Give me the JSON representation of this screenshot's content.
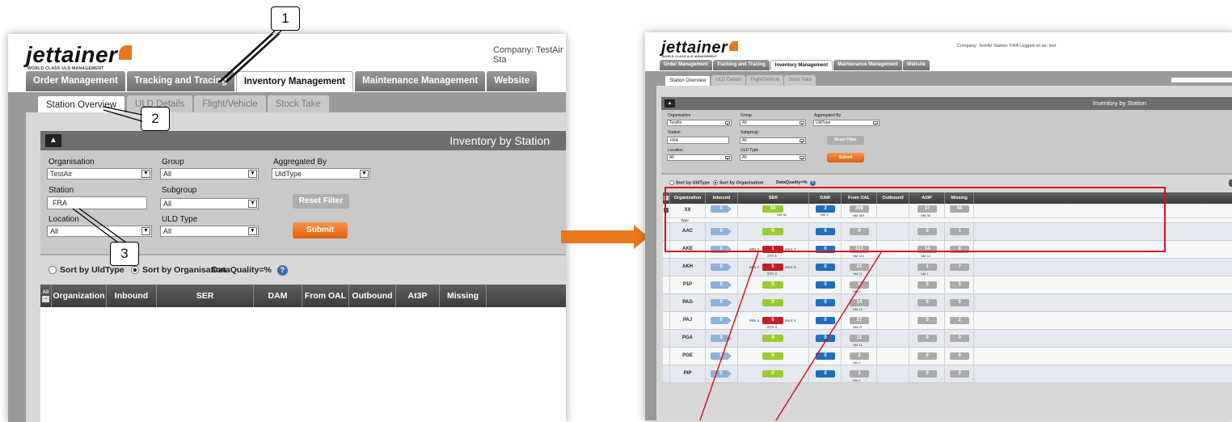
{
  "left": {
    "brand": "jettainer",
    "tagline": "WORLD CLASS ULD MANAGEMENT",
    "company_text": "Company: TestAir   Sta",
    "main_tabs": [
      "Order Management",
      "Tracking and Tracing",
      "Inventory Management",
      "Maintenance Management",
      "Website"
    ],
    "sub_tabs": [
      "Station Overview",
      "ULD Details",
      "Flight/Vehicle",
      "Stock Take"
    ],
    "panel_title": "Inventory by Station",
    "filters": {
      "organisation_label": "Organisation",
      "organisation_value": "TestAir",
      "group_label": "Group",
      "group_value": "All",
      "aggregated_label": "Aggregated By",
      "aggregated_value": "UldType",
      "station_label": "Station",
      "station_value": "FRA",
      "subgroup_label": "Subgroup",
      "subgroup_value": "All",
      "location_label": "Location",
      "location_value": "All",
      "uldtype_label": "ULD Type",
      "uldtype_value": "All"
    },
    "reset_label": "Reset Filter",
    "submit_label": "Submit",
    "sort_uld": "Sort by UldType",
    "sort_org": "Sort by Organisation",
    "dq": "DataQuality=%",
    "columns": [
      "Organization",
      "Inbound",
      "SER",
      "DAM",
      "From OAL",
      "Outbound",
      "At3P",
      "Missing"
    ],
    "all_label": "All",
    "callouts": [
      "1",
      "2",
      "3"
    ]
  },
  "right": {
    "brand": "jettainer",
    "tagline": "WORLD CLASS ULD MANAGEMENT",
    "company_text": "Company: TestAir   Station: FRA   Logged on as: test",
    "main_tabs": [
      "Order Management",
      "Tracking and Tracing",
      "Inventory Management",
      "Maintenance Management",
      "Website"
    ],
    "sub_tabs": [
      "Station Overview",
      "ULD Details",
      "Flight/Vehicle",
      "Stock Take"
    ],
    "panel_title": "Inventory by Station",
    "filters": {
      "organisation_label": "Organisation",
      "organisation_value": "TestAir",
      "group_label": "Group",
      "group_value": "All",
      "aggregated_label": "Aggregated By",
      "aggregated_value": "UldType",
      "station_label": "Station",
      "station_value": "FRA",
      "subgroup_label": "Subgroup",
      "subgroup_value": "All",
      "location_label": "Location",
      "location_value": "All",
      "uldtype_label": "ULD Type",
      "uldtype_value": "All"
    },
    "reset_label": "Reset Filter",
    "submit_label": "Submit",
    "sort_uld": "Sort by UldType",
    "sort_org": "Sort by Organisation",
    "dq": "DataQuality=%",
    "columns": [
      "Organization",
      "Inbound",
      "SER",
      "DAM",
      "From OAL",
      "Outbound",
      "At3P",
      "Missing"
    ],
    "type_label": "Type",
    "rows": [
      {
        "name": "XX",
        "inbound": "0",
        "ser": "39",
        "ser_sub": "NM 36",
        "ser_color": "gr",
        "dam": "2",
        "dam_sub": "NM 2",
        "oal": "369",
        "oal_sub": "NM 369",
        "at3p": "37",
        "at3p_sub": "NM 36",
        "missing": "88"
      },
      {
        "name": "AAC",
        "inbound": "0",
        "ser": "0",
        "ser_color": "gr",
        "dam": "0",
        "oal": "0",
        "at3p": "0",
        "missing": "1"
      },
      {
        "name": "AKE",
        "inbound": "0",
        "ser": "1",
        "ser_color": "rd",
        "min": "MIN 3",
        "max": "MAX 7",
        "sta": "STA 5",
        "dam": "0",
        "oal": "113",
        "oal_sub": "NM 113",
        "at3p": "14",
        "at3p_sub": "NM 14",
        "missing": "6"
      },
      {
        "name": "AKH",
        "inbound": "0",
        "ser": "0",
        "ser_color": "rd",
        "min": "MIN 2",
        "max": "MAX 6",
        "sta": "STA 4",
        "dam": "0",
        "oal": "21",
        "oal_sub": "NM 21",
        "at3p": "1",
        "at3p_sub": "NM 1",
        "missing": "7"
      },
      {
        "name": "P1P",
        "inbound": "0",
        "ser": "0",
        "ser_color": "gr",
        "dam": "0",
        "oal": "6",
        "oal_sub": "NM 6",
        "at3p": "0",
        "missing": "0"
      },
      {
        "name": "PAG",
        "inbound": "0",
        "ser": "0",
        "ser_color": "gr",
        "dam": "0",
        "oal": "14",
        "oal_sub": "NM 14",
        "at3p": "0",
        "missing": "0"
      },
      {
        "name": "PAJ",
        "inbound": "0",
        "ser": "0",
        "ser_color": "rd",
        "min": "MIN 4",
        "max": "MAX 4",
        "sta": "STA 4",
        "dam": "0",
        "oal": "27",
        "oal_sub": "NM 27",
        "at3p": "0",
        "missing": "2"
      },
      {
        "name": "PGA",
        "inbound": "0",
        "ser": "0",
        "ser_color": "gr",
        "dam": "0",
        "oal": "11",
        "oal_sub": "NM 11",
        "at3p": "0",
        "missing": "0"
      },
      {
        "name": "PGE",
        "inbound": "0",
        "ser": "0",
        "ser_color": "gr",
        "dam": "0",
        "oal": "2",
        "oal_sub": "NM 2",
        "at3p": "0",
        "missing": "0"
      },
      {
        "name": "PIP",
        "inbound": "0",
        "ser": "0",
        "ser_color": "gr",
        "dam": "0",
        "oal": "2",
        "oal_sub": "NM 2",
        "at3p": "0",
        "missing": "0"
      }
    ]
  },
  "colors": {
    "accent": "#e8781c",
    "highlight": "#e0101a",
    "dark_header": "#4a4a4a"
  }
}
